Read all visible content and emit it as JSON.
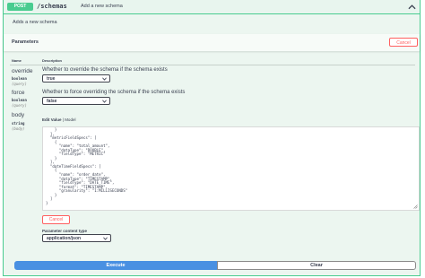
{
  "operation": {
    "method": "POST",
    "path": "/schemas",
    "summary": "Add a new schema",
    "description": "Adds a new schema"
  },
  "parameters_section": {
    "title": "Parameters",
    "cancel_label": "Cancel",
    "col_name": "Name",
    "col_description": "Description"
  },
  "params": [
    {
      "name": "override",
      "type": "boolean",
      "in": "(query)",
      "description": "Whether to override the schema if the schema exists",
      "value": "true"
    },
    {
      "name": "force",
      "type": "boolean",
      "in": "(query)",
      "description": "Whether to force overriding the schema if the schema exists",
      "value": "false"
    },
    {
      "name": "body",
      "type": "string",
      "in": "(body)"
    }
  ],
  "body_editor": {
    "tab_edit": "Edit Value",
    "tab_sep": " | ",
    "tab_model": "Model",
    "lines": [
      "    }",
      "  ],",
      "  \"metricFieldSpecs\": [",
      "    {",
      "      \"name\": \"total_amount\",",
      "      \"dataType\": \"DOUBLE\",",
      "      \"fieldType\": \"METRIC\"",
      "    }",
      "  ],",
      "  \"dateTimeFieldSpecs\": [",
      "    {",
      "      \"name\": \"order_date\",",
      "      \"dataType\": \"TIMESTAMP\",",
      "      \"fieldType\": \"DATE_TIME\",",
      "      \"format\": \"TIMESTAMP\",",
      "      \"granularity\": \"1:MILLISECONDS\"",
      "    }",
      "  ]",
      "}"
    ],
    "cancel_label": "Cancel"
  },
  "content_type": {
    "label": "Parameter content type",
    "value": "application/json"
  },
  "actions": {
    "execute_label": "Execute",
    "clear_label": "Clear"
  },
  "colors": {
    "post_green": "#49cc90",
    "panel_bg": "#ecf6f0",
    "cancel_red": "#ff6060",
    "execute_blue": "#4990e2"
  }
}
